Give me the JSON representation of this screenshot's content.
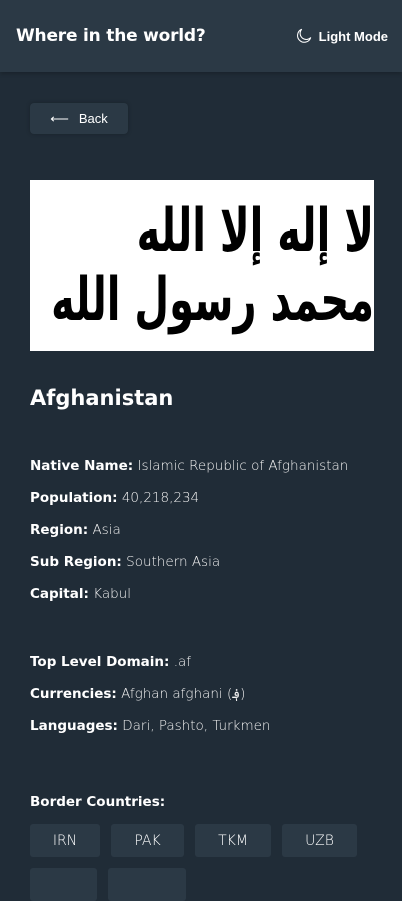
{
  "header": {
    "title": "Where in the world?",
    "mode_label": "Light Mode",
    "mode_icon": "moon-icon"
  },
  "back": {
    "label": "Back",
    "icon": "arrow-left-icon",
    "arrow": "⟵"
  },
  "flag": {
    "lettering": "لا إله إلا الله محمد رسول الله"
  },
  "country": {
    "name": "Afghanistan",
    "details": [
      {
        "label": "Native Name:",
        "value": "Islamic Republic of Afghanistan"
      },
      {
        "label": "Population:",
        "value": "40,218,234"
      },
      {
        "label": "Region:",
        "value": "Asia"
      },
      {
        "label": "Sub Region:",
        "value": "Southern Asia"
      },
      {
        "label": "Capital:",
        "value": "Kabul"
      }
    ],
    "details2": [
      {
        "label": "Top Level Domain:",
        "value": ".af"
      },
      {
        "label": "Currencies:",
        "value": "Afghan afghani (؋)"
      },
      {
        "label": "Languages:",
        "value": "Dari, Pashto, Turkmen"
      }
    ],
    "border_label": "Border Countries:",
    "borders": [
      "IRN",
      "PAK",
      "TKM",
      "UZB"
    ]
  },
  "colors": {
    "background": "#202c37",
    "surface": "#2b3945",
    "text": "#ffffff"
  }
}
